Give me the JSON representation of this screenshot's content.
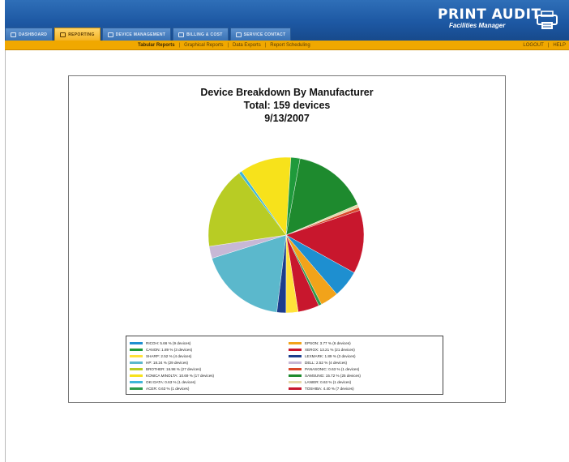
{
  "header": {
    "logo_text": "PRINT AUDIT",
    "logo_subtext": "Facilities Manager",
    "tabs": [
      {
        "label": "DASHBOARD",
        "active": false
      },
      {
        "label": "REPORTING",
        "active": true
      },
      {
        "label": "DEVICE MANAGEMENT",
        "active": false
      },
      {
        "label": "BILLING & COST",
        "active": false
      },
      {
        "label": "SERVICE CONTACT",
        "active": false
      }
    ]
  },
  "subnav": {
    "links": [
      "Tabular Reports",
      "Graphical Reports",
      "Data Exports",
      "Report Scheduling"
    ],
    "current": "Tabular Reports",
    "right": [
      "LOGOUT",
      "HELP"
    ]
  },
  "report": {
    "title_line1": "Device Breakdown By Manufacturer",
    "title_line2": "Total: 159 devices",
    "title_line3": "9/13/2007"
  },
  "chart_data": {
    "type": "pie",
    "title": "Device Breakdown By Manufacturer",
    "slices": [
      {
        "label": "RICOH: 5.66 % (9 devices)",
        "value": 9,
        "color": "#1e8fd0"
      },
      {
        "label": "CANON: 1.89 % (3 devices)",
        "value": 3,
        "color": "#1f9a3b"
      },
      {
        "label": "SHARP: 2.52 % (4 devices)",
        "value": 4,
        "color": "#ffe23a"
      },
      {
        "label": "HP: 18.24 % (29 devices)",
        "value": 29,
        "color": "#5bb8cc"
      },
      {
        "label": "BROTHER: 16.98 % (27 devices)",
        "value": 27,
        "color": "#b8cc24"
      },
      {
        "label": "KONICA MINOLTA: 10.69 % (17 devices)",
        "value": 17,
        "color": "#f7e21b"
      },
      {
        "label": "OKI DATA: 0.63 % (1 devices)",
        "value": 1,
        "color": "#3fb6d8"
      },
      {
        "label": "ACER: 0.63 % (1 devices)",
        "value": 1,
        "color": "#2c9a4a"
      },
      {
        "label": "EPSON: 3.77 % (6 devices)",
        "value": 6,
        "color": "#f2a31a"
      },
      {
        "label": "XEROX: 13.21 % (21 devices)",
        "value": 21,
        "color": "#c8172d"
      },
      {
        "label": "LEXMARK: 1.89 % (3 devices)",
        "value": 3,
        "color": "#1c3d8c"
      },
      {
        "label": "DELL: 2.52 % (4 devices)",
        "value": 4,
        "color": "#c7b8d6"
      },
      {
        "label": "PANASONIC: 0.63 % (1 devices)",
        "value": 1,
        "color": "#d9482b"
      },
      {
        "label": "SAMSUNG: 15.72 % (25 devices)",
        "value": 25,
        "color": "#1e8a2e"
      },
      {
        "label": "LANIER: 0.63 % (1 devices)",
        "value": 1,
        "color": "#e6d8a8"
      },
      {
        "label": "TOSHIBA: 4.40 % (7 devices)",
        "value": 7,
        "color": "#c8172d"
      }
    ]
  }
}
